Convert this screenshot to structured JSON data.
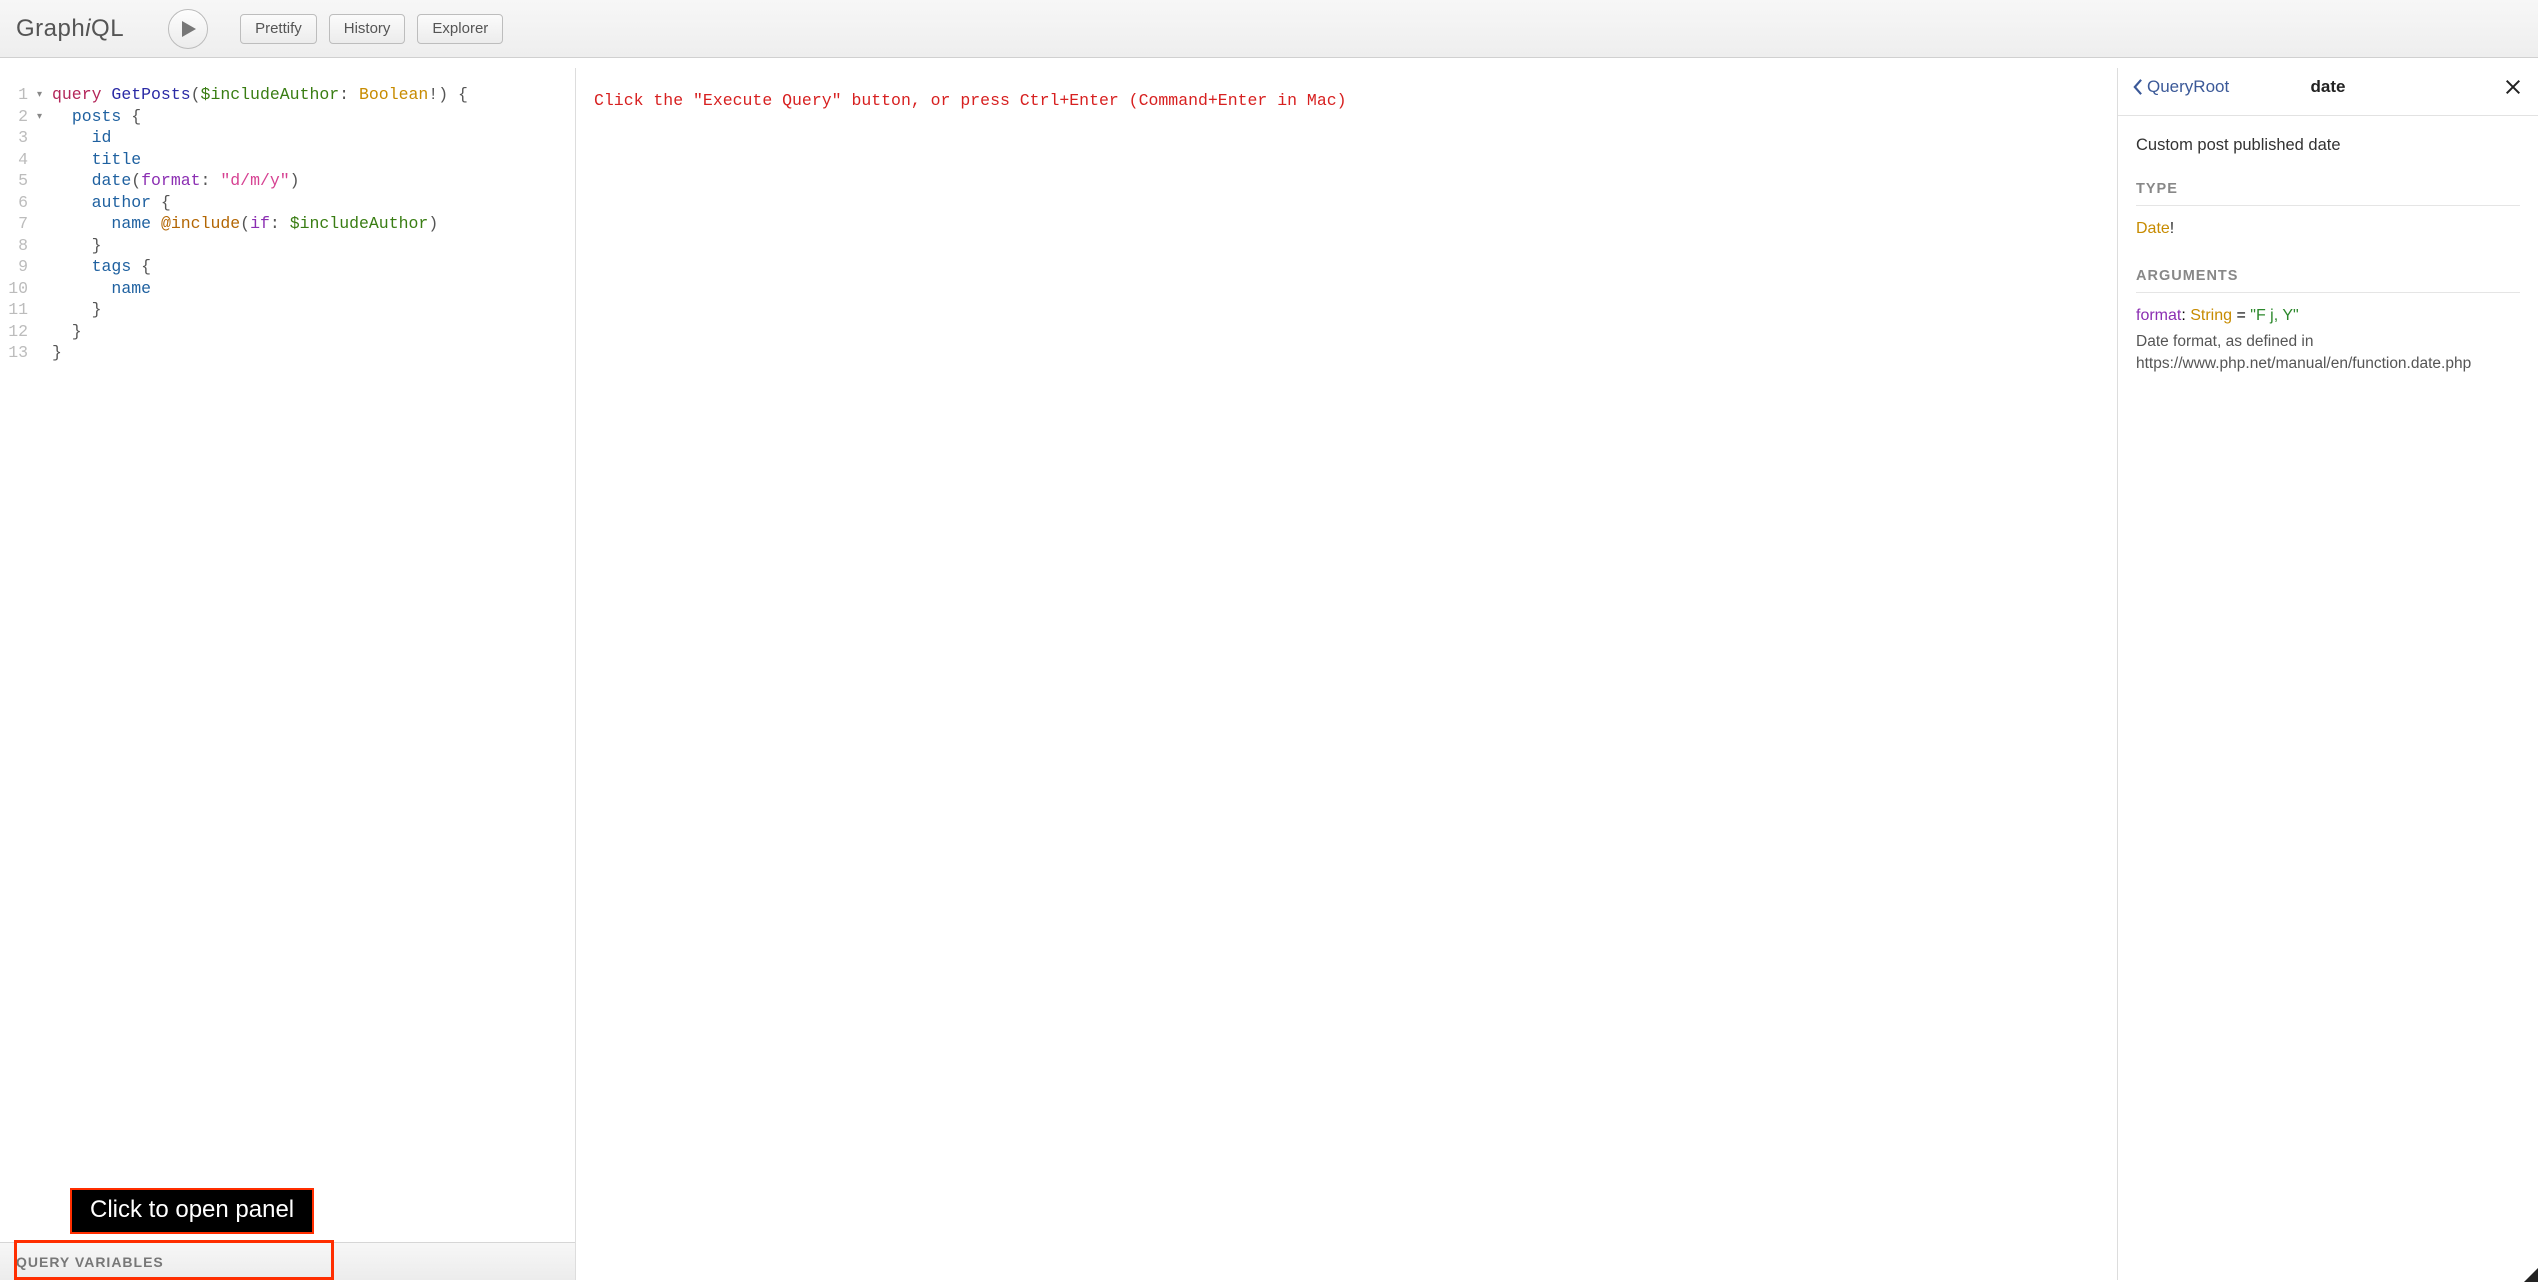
{
  "logo": {
    "pre": "Graph",
    "em": "i",
    "post": "QL"
  },
  "toolbar": {
    "prettify": "Prettify",
    "history": "History",
    "explorer": "Explorer"
  },
  "editor": {
    "lines": 13,
    "foldable": [
      1,
      2
    ],
    "tokens": [
      [
        [
          "kw",
          "query"
        ],
        [
          "punc",
          " "
        ],
        [
          "def",
          "GetPosts"
        ],
        [
          "punc",
          "("
        ],
        [
          "var",
          "$includeAuthor"
        ],
        [
          "punc",
          ": "
        ],
        [
          "type",
          "Boolean"
        ],
        [
          "punc",
          "!) {"
        ]
      ],
      [
        [
          "punc",
          "  "
        ],
        [
          "field",
          "posts"
        ],
        [
          "punc",
          " {"
        ]
      ],
      [
        [
          "punc",
          "    "
        ],
        [
          "field",
          "id"
        ]
      ],
      [
        [
          "punc",
          "    "
        ],
        [
          "field",
          "title"
        ]
      ],
      [
        [
          "punc",
          "    "
        ],
        [
          "field",
          "date"
        ],
        [
          "punc",
          "("
        ],
        [
          "arg",
          "format"
        ],
        [
          "punc",
          ": "
        ],
        [
          "str",
          "\"d/m/y\""
        ],
        [
          "punc",
          ")"
        ]
      ],
      [
        [
          "punc",
          "    "
        ],
        [
          "field",
          "author"
        ],
        [
          "punc",
          " {"
        ]
      ],
      [
        [
          "punc",
          "      "
        ],
        [
          "field",
          "name"
        ],
        [
          "punc",
          " "
        ],
        [
          "dir",
          "@include"
        ],
        [
          "punc",
          "("
        ],
        [
          "arg",
          "if"
        ],
        [
          "punc",
          ": "
        ],
        [
          "var",
          "$includeAuthor"
        ],
        [
          "punc",
          ")"
        ]
      ],
      [
        [
          "punc",
          "    }"
        ]
      ],
      [
        [
          "punc",
          "    "
        ],
        [
          "field",
          "tags"
        ],
        [
          "punc",
          " {"
        ]
      ],
      [
        [
          "punc",
          "      "
        ],
        [
          "field",
          "name"
        ]
      ],
      [
        [
          "punc",
          "    }"
        ]
      ],
      [
        [
          "punc",
          "  }"
        ]
      ],
      [
        [
          "punc",
          "}"
        ]
      ]
    ],
    "variables_title": "Query Variables"
  },
  "tooltip": "Click to open panel",
  "result": "Click the \"Execute Query\" button, or press Ctrl+Enter (Command+Enter in Mac)",
  "docs": {
    "back_label": "QueryRoot",
    "title": "date",
    "description": "Custom post published date",
    "type_heading": "Type",
    "type_name": "Date",
    "type_required": "!",
    "args_heading": "Arguments",
    "arg": {
      "name": "format",
      "sep": ": ",
      "type": "String",
      "eq": " = ",
      "default": "\"F j, Y\"",
      "desc": "Date format, as defined in https://www.php.net/manual/en/function.date.php"
    }
  }
}
